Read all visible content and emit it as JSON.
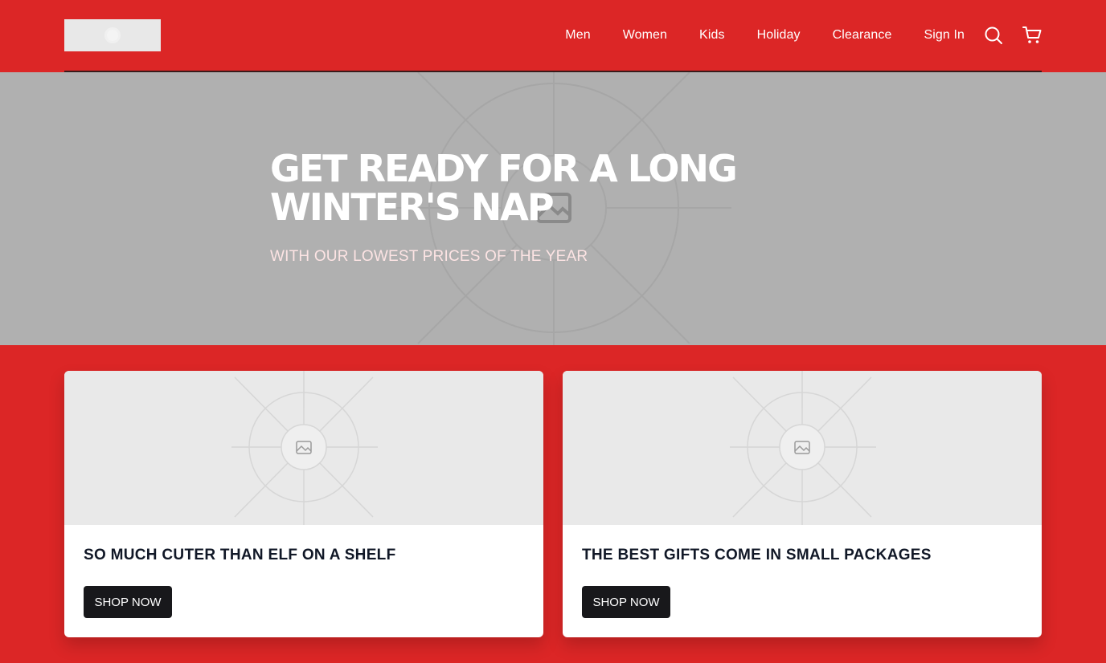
{
  "header": {
    "logo_alt": "logo",
    "nav": [
      {
        "label": "Men"
      },
      {
        "label": "Women"
      },
      {
        "label": "Kids"
      },
      {
        "label": "Holiday"
      },
      {
        "label": "Clearance"
      },
      {
        "label": "Sign In"
      }
    ],
    "icons": [
      "search-icon",
      "cart-icon"
    ]
  },
  "hero": {
    "title": "GET READY FOR A LONG WINTER'S NAP",
    "subtitle": "WITH OUR LOWEST PRICES OF THE YEAR"
  },
  "cards": [
    {
      "title": "SO MUCH CUTER THAN ELF ON A SHELF",
      "button": "SHOP NOW"
    },
    {
      "title": "THE BEST GIFTS COME IN SMALL PACKAGES",
      "button": "SHOP NOW"
    }
  ],
  "colors": {
    "brand_red": "#dc2626",
    "button_dark": "#18181b",
    "hero_gray": "#b0b0b0"
  }
}
